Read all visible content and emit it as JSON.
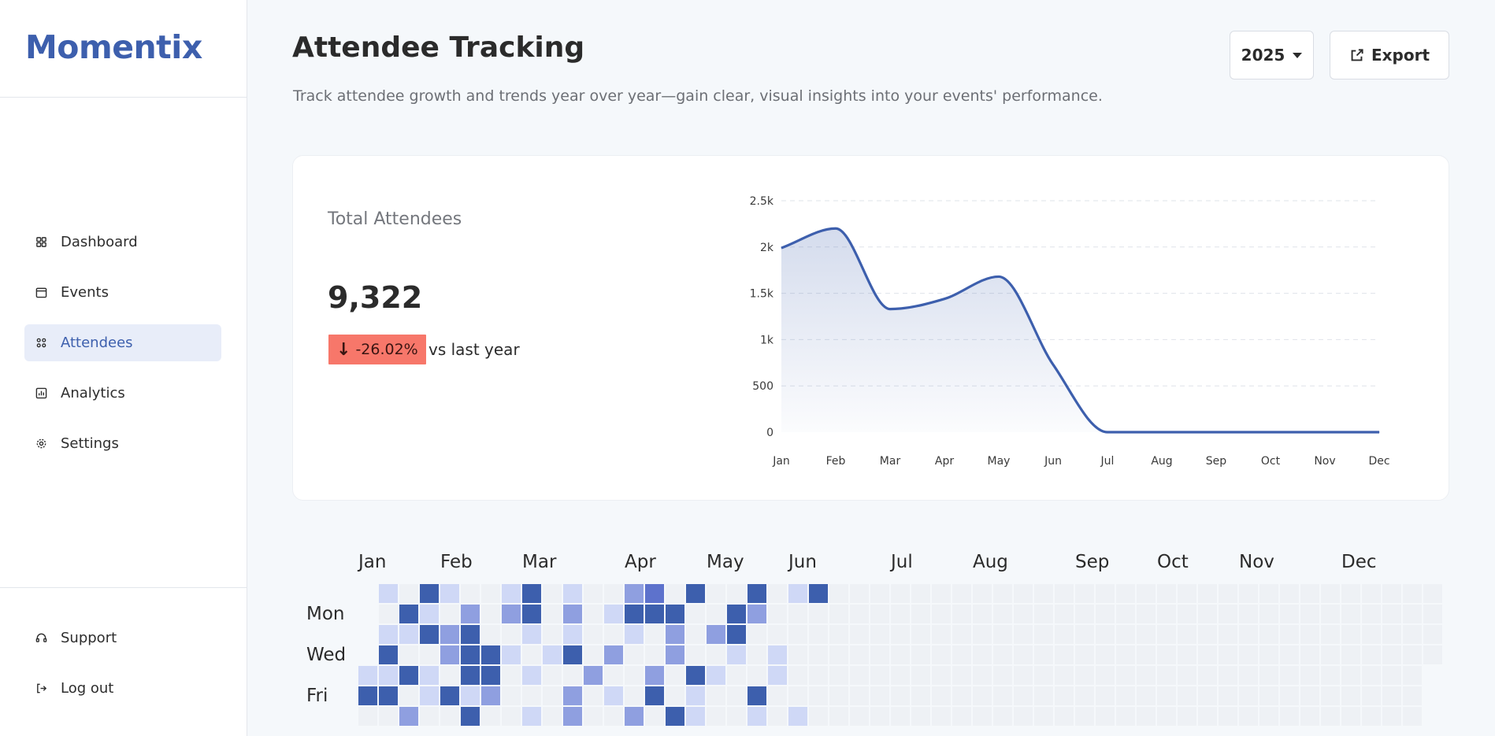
{
  "app": {
    "brand": "Momentix"
  },
  "sidebar": {
    "items": [
      {
        "label": "Dashboard",
        "icon": "dashboard-icon",
        "active": false
      },
      {
        "label": "Events",
        "icon": "calendar-icon",
        "active": false
      },
      {
        "label": "Attendees",
        "icon": "attendees-icon",
        "active": true
      },
      {
        "label": "Analytics",
        "icon": "analytics-icon",
        "active": false
      },
      {
        "label": "Settings",
        "icon": "gear-icon",
        "active": false
      }
    ],
    "bottom": [
      {
        "label": "Support",
        "icon": "headset-icon"
      },
      {
        "label": "Log out",
        "icon": "logout-icon"
      }
    ]
  },
  "header": {
    "title": "Attendee Tracking",
    "subtitle": "Track attendee growth and trends year over year—gain clear, visual insights into your events' performance.",
    "year": "2025",
    "export_label": "Export"
  },
  "summary": {
    "label": "Total Attendees",
    "value": "9,322",
    "delta": "-26.02%",
    "delta_arrow": "↓",
    "delta_suffix": "vs last year"
  },
  "colors": {
    "accent": "#3d5fad",
    "negative": "#f7776a",
    "heat_empty": "#eef1f5",
    "heat_levels": [
      "#eef1f5",
      "#cfd8f6",
      "#8f9fe0",
      "#5d72cc",
      "#3d5fad"
    ]
  },
  "chart_data": {
    "type": "area",
    "categories": [
      "Jan",
      "Feb",
      "Mar",
      "Apr",
      "May",
      "Jun",
      "Jul",
      "Aug",
      "Sep",
      "Oct",
      "Nov",
      "Dec"
    ],
    "series": [
      {
        "values": [
          1990,
          2200,
          1330,
          1440,
          1680,
          730,
          0,
          0,
          0,
          0,
          0,
          0
        ]
      }
    ],
    "yticks": [
      "0",
      "500",
      "1k",
      "1.5k",
      "2k",
      "2.5k"
    ],
    "ylim": [
      0,
      2500
    ],
    "grid": true
  },
  "heatmap": {
    "months": [
      "Jan",
      "Feb",
      "Mar",
      "Apr",
      "May",
      "Jun",
      "Jul",
      "Aug",
      "Sep",
      "Oct",
      "Nov",
      "Dec"
    ],
    "day_labels": [
      "Mon",
      "Wed",
      "Fri"
    ],
    "weeks": 53,
    "active_weeks": 24,
    "levels": [
      [
        0,
        1,
        0,
        4,
        1,
        0,
        0,
        1,
        4,
        0,
        1,
        0,
        0,
        2,
        3,
        0,
        4,
        0,
        0,
        4,
        0,
        1,
        4
      ],
      [
        1,
        0,
        4,
        1,
        0,
        2,
        0,
        2,
        4,
        0,
        2,
        0,
        1,
        4,
        4,
        4,
        0,
        0,
        4,
        2,
        0,
        0,
        0
      ],
      [
        0,
        1,
        1,
        4,
        2,
        4,
        0,
        0,
        1,
        0,
        1,
        0,
        0,
        1,
        0,
        2,
        0,
        2,
        4,
        0,
        0,
        0,
        0
      ],
      [
        0,
        4,
        0,
        0,
        2,
        4,
        4,
        1,
        0,
        1,
        4,
        0,
        2,
        0,
        0,
        2,
        0,
        0,
        1,
        0,
        1,
        0,
        0
      ],
      [
        1,
        1,
        4,
        1,
        0,
        4,
        4,
        0,
        1,
        0,
        0,
        2,
        0,
        0,
        2,
        0,
        4,
        1,
        0,
        0,
        1,
        0,
        0
      ],
      [
        4,
        4,
        0,
        1,
        4,
        1,
        2,
        0,
        0,
        0,
        2,
        0,
        1,
        0,
        4,
        0,
        1,
        0,
        0,
        4,
        0,
        0,
        0
      ],
      [
        0,
        0,
        2,
        0,
        0,
        4,
        0,
        0,
        1,
        0,
        2,
        0,
        0,
        2,
        0,
        4,
        1,
        0,
        0,
        1,
        0,
        1,
        0
      ]
    ]
  }
}
